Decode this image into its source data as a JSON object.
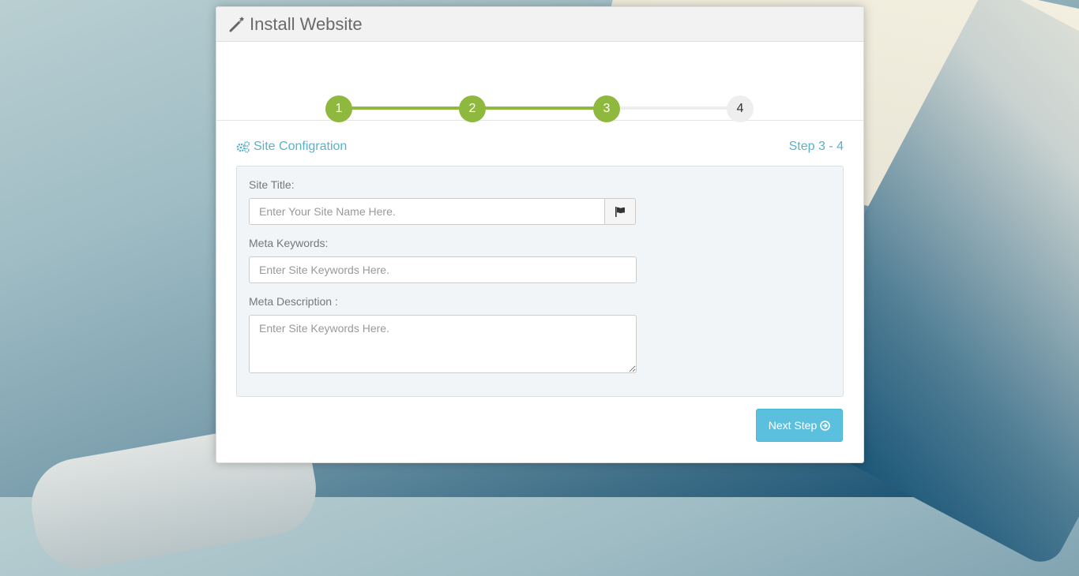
{
  "header": {
    "title": "Install Website",
    "icon": "magic-wand-icon"
  },
  "wizard": {
    "steps": [
      {
        "label": "1",
        "state": "complete"
      },
      {
        "label": "2",
        "state": "complete"
      },
      {
        "label": "3",
        "state": "active"
      },
      {
        "label": "4",
        "state": "pending"
      }
    ],
    "accent_color": "#8fb83f"
  },
  "section": {
    "title": "Site Configration",
    "icon": "gears-icon",
    "step_counter": "Step 3 - 4"
  },
  "form": {
    "site_title": {
      "label": "Site Title:",
      "placeholder": "Enter Your Site Name Here.",
      "addon_icon": "flag-icon"
    },
    "meta_keywords": {
      "label": "Meta Keywords:",
      "placeholder": "Enter Site Keywords Here."
    },
    "meta_description": {
      "label": "Meta Description :",
      "placeholder": "Enter Site Keywords Here."
    }
  },
  "actions": {
    "next_label": "Next Step",
    "next_icon": "circle-arrow-right-icon"
  }
}
